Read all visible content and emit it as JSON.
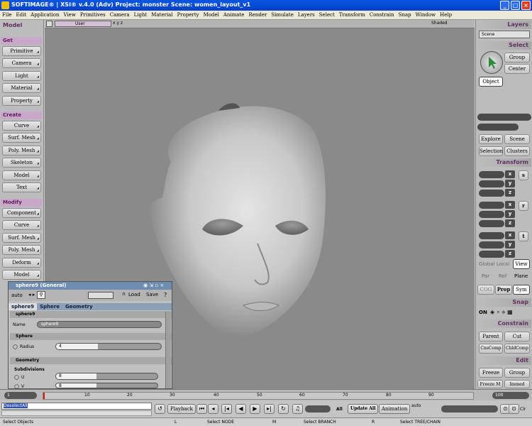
{
  "window": {
    "title": "SOFTIMAGE® | XSI® v.4.0 (Adv) Project: monster    Scene: women_layout_v1",
    "buttons": [
      "_",
      "□",
      "×"
    ]
  },
  "menu": [
    "File",
    "Edit",
    "Application",
    "View",
    "Primitives",
    "Camera",
    "Light",
    "Material",
    "Property",
    "Model",
    "Animate",
    "Render",
    "Simulate",
    "Layers",
    "Select",
    "Transform",
    "Constrain",
    "Snap",
    "Window",
    "Help"
  ],
  "left_panel": {
    "title": "Model",
    "get": {
      "label": "Get",
      "items": [
        "Primitive",
        "Camera",
        "Light",
        "Material",
        "Property"
      ]
    },
    "create": {
      "label": "Create",
      "items": [
        "Curve",
        "Surf. Mesh",
        "Poly. Mesh",
        "Skeleton",
        "Model",
        "Text"
      ]
    },
    "modify": {
      "label": "Modify",
      "items": [
        "Component",
        "Curve",
        "Surf. Mesh",
        "Poly. Mesh",
        "Deform",
        "Model"
      ]
    }
  },
  "viewport": {
    "camera": "User",
    "shading": "Shaded",
    "axes": "x  y  z"
  },
  "property_editor": {
    "title": "sphere9 (General)",
    "preset": "auto",
    "load": "Load",
    "save": "Save",
    "help": "?",
    "tabs": [
      "sphere9",
      "Sphere",
      "Geometry"
    ],
    "sec_obj": "sphere9",
    "name_label": "Name",
    "name_value": "sphere9",
    "sec_sphere": "Sphere",
    "radius_label": "Radius",
    "radius_value": "4",
    "sec_geometry": "Geometry",
    "subdivisions_label": "Subdivisions",
    "u_label": "U",
    "u_value": "8",
    "v_label": "V",
    "v_value": "8"
  },
  "right_panel": {
    "layers": "Layers",
    "layer_value": "Scene",
    "select": "Select",
    "group": "Group",
    "center": "Center",
    "object": "Object",
    "explore": "Explore",
    "scene": "Scene",
    "selection": "Selection",
    "clusters": "Clusters",
    "transform": "Transform",
    "s": "s",
    "r": "r",
    "t": "t",
    "x": "x",
    "y": "y",
    "z": "z",
    "global": "Global",
    "local": "Local",
    "view": "View",
    "par": "Par",
    "ref": "Ref",
    "plane": "Plane",
    "cog": "COG",
    "prop": "Prop",
    "sym": "Sym",
    "snap": "Snap",
    "snap_on": "ON",
    "constrain": "Constrain",
    "parent": "Parent",
    "cut": "Cut",
    "cnscomp": "CnsComp",
    "chldcomp": "ChldComp",
    "edit": "Edit",
    "freeze": "Freeze",
    "group2": "Group",
    "freeze_m": "Freeze M",
    "immed": "Immed"
  },
  "timeline": {
    "ticks": [
      "10",
      "20",
      "30",
      "40",
      "50",
      "60",
      "70",
      "80",
      "90"
    ],
    "current": "1",
    "end": "100"
  },
  "playback": {
    "command_line": "DeselectAll",
    "playback": "Playback",
    "all": "All",
    "update_all": "Update All",
    "animation": "Animation",
    "auto": "auto",
    "clr": "Clr"
  },
  "status": {
    "left": "Select Objects",
    "l": "L",
    "l_action": "Select NODE",
    "m": "M",
    "m_action": "Select BRANCH",
    "r": "R",
    "r_action": "Select TREE/CHAIN"
  }
}
